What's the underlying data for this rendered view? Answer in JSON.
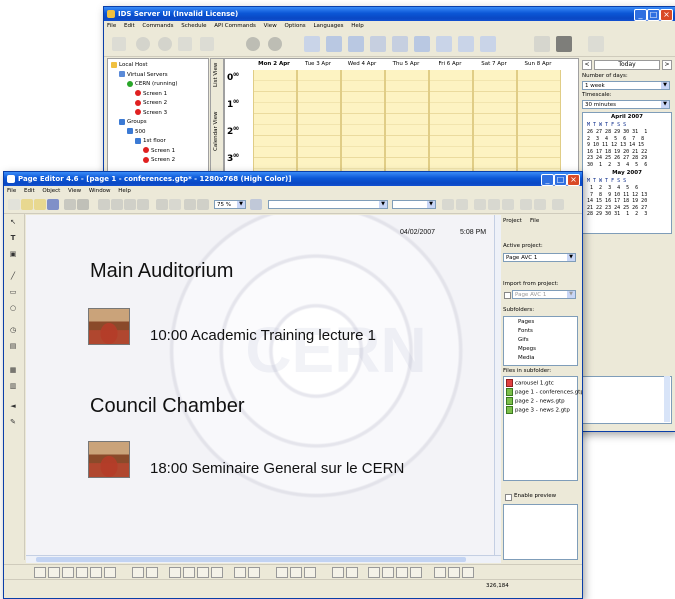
{
  "ids_window": {
    "title": "IDS Server UI (Invalid License)",
    "menu": [
      "File",
      "Edit",
      "Commands",
      "Schedule",
      "API Commands",
      "View",
      "Options",
      "Languages",
      "Help"
    ],
    "tree": [
      {
        "label": "Local Host",
        "indent": 0,
        "icon": "computer-icon"
      },
      {
        "label": "Virtual Servers",
        "indent": 1,
        "icon": "servers-icon"
      },
      {
        "label": "CERN (running)",
        "indent": 2,
        "icon": "running-icon"
      },
      {
        "label": "Screen 1",
        "indent": 3,
        "icon": "no-entry-icon"
      },
      {
        "label": "Screen 2",
        "indent": 3,
        "icon": "no-entry-icon"
      },
      {
        "label": "Screen 3",
        "indent": 3,
        "icon": "no-entry-icon"
      },
      {
        "label": "Groups",
        "indent": 1,
        "icon": "group-icon"
      },
      {
        "label": "500",
        "indent": 2,
        "icon": "group-icon"
      },
      {
        "label": "1st floor",
        "indent": 3,
        "icon": "group-icon"
      },
      {
        "label": "Screen 1",
        "indent": 4,
        "icon": "no-entry-icon"
      },
      {
        "label": "Screen 2",
        "indent": 4,
        "icon": "no-entry-icon"
      }
    ],
    "view_tabs": [
      "List View",
      "Calendar View"
    ],
    "days": [
      "Mon 2 Apr",
      "Tue 3 Apr",
      "Wed 4 Apr",
      "Thu 5 Apr",
      "Fri 6 Apr",
      "Sat 7 Apr",
      "Sun 8 Apr"
    ],
    "hours": [
      "0",
      "1",
      "2",
      "3"
    ],
    "hour_suffix": "00",
    "today_label": "Today",
    "nav_prev": "<",
    "nav_next": ">",
    "number_of_days_label": "Number of days:",
    "number_of_days_value": "1 week",
    "timescale_label": "Timescale:",
    "timescale_value": "30 minutes",
    "april_title": "April 2007",
    "weekdays": "M T W T F S S",
    "april_rows": [
      "26 27 28 29 30 31  1",
      "2  3  4  5  6  7  8",
      "9 10 11 12 13 14 15",
      "16 17 18 19 20 21 22",
      "23 24 25 26 27 28 29",
      "30  1  2  3  4  5  6"
    ],
    "may_title": "May 2007",
    "may_rows": [
      " 1  2  3  4  5  6",
      " 7  8  9 10 11 12 13",
      "14 15 16 17 18 19 20",
      "21 22 23 24 25 26 27",
      "28 29 30 31  1  2  3"
    ]
  },
  "page_editor": {
    "title": "Page Editor 4.6 - [page 1 - conferences.gtp* - 1280x768 (High Color)]",
    "menu": [
      "File",
      "Edit",
      "Object",
      "View",
      "Window",
      "Help"
    ],
    "zoom": "75 %",
    "slide": {
      "date": "04/02/2007",
      "time": "5:08 PM",
      "heading1": "Main Auditorium",
      "event1": "10:00  Academic Training lecture 1",
      "heading2": "Council Chamber",
      "event2": "18:00  Seminaire General sur le CERN"
    },
    "side_panel": {
      "tabs": [
        "Project",
        "File"
      ],
      "active_project_label": "Active project:",
      "active_project_value": "Page AVC 1",
      "import_label": "Import from project:",
      "import_value": "Page AVC 1",
      "subfolders_label": "Subfolders:",
      "subfolders": [
        "Pages",
        "Fonts",
        "Gifs",
        "Mpegs",
        "Media"
      ],
      "files_label": "Files in subfolder:",
      "files": [
        "carousel 1.gtc",
        "page 1 - conferences.gtp",
        "page 2 - news.gtp",
        "page 3 - news 2.gtp"
      ],
      "enable_preview": "Enable preview"
    },
    "status_coords": "326,184"
  }
}
